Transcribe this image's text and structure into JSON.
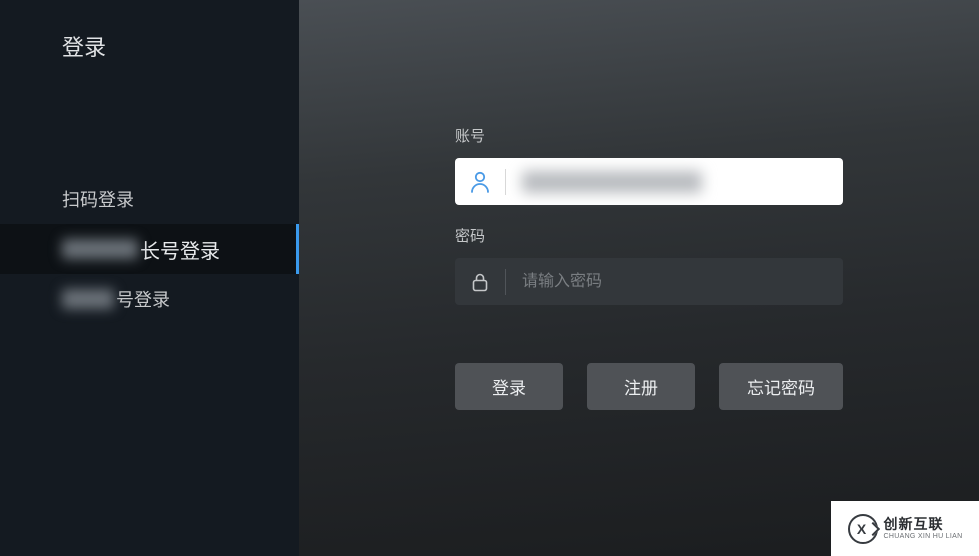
{
  "sidebar": {
    "title": "登录",
    "items": [
      {
        "label": "扫码登录"
      },
      {
        "suffix": "长号登录"
      },
      {
        "suffix": "号登录"
      }
    ]
  },
  "form": {
    "account": {
      "label": "账号"
    },
    "password": {
      "label": "密码",
      "placeholder": "请输入密码"
    }
  },
  "buttons": {
    "login": "登录",
    "register": "注册",
    "forgot": "忘记密码"
  },
  "watermark": {
    "cn": "创新互联",
    "en": "CHUANG XIN HU LIAN"
  }
}
